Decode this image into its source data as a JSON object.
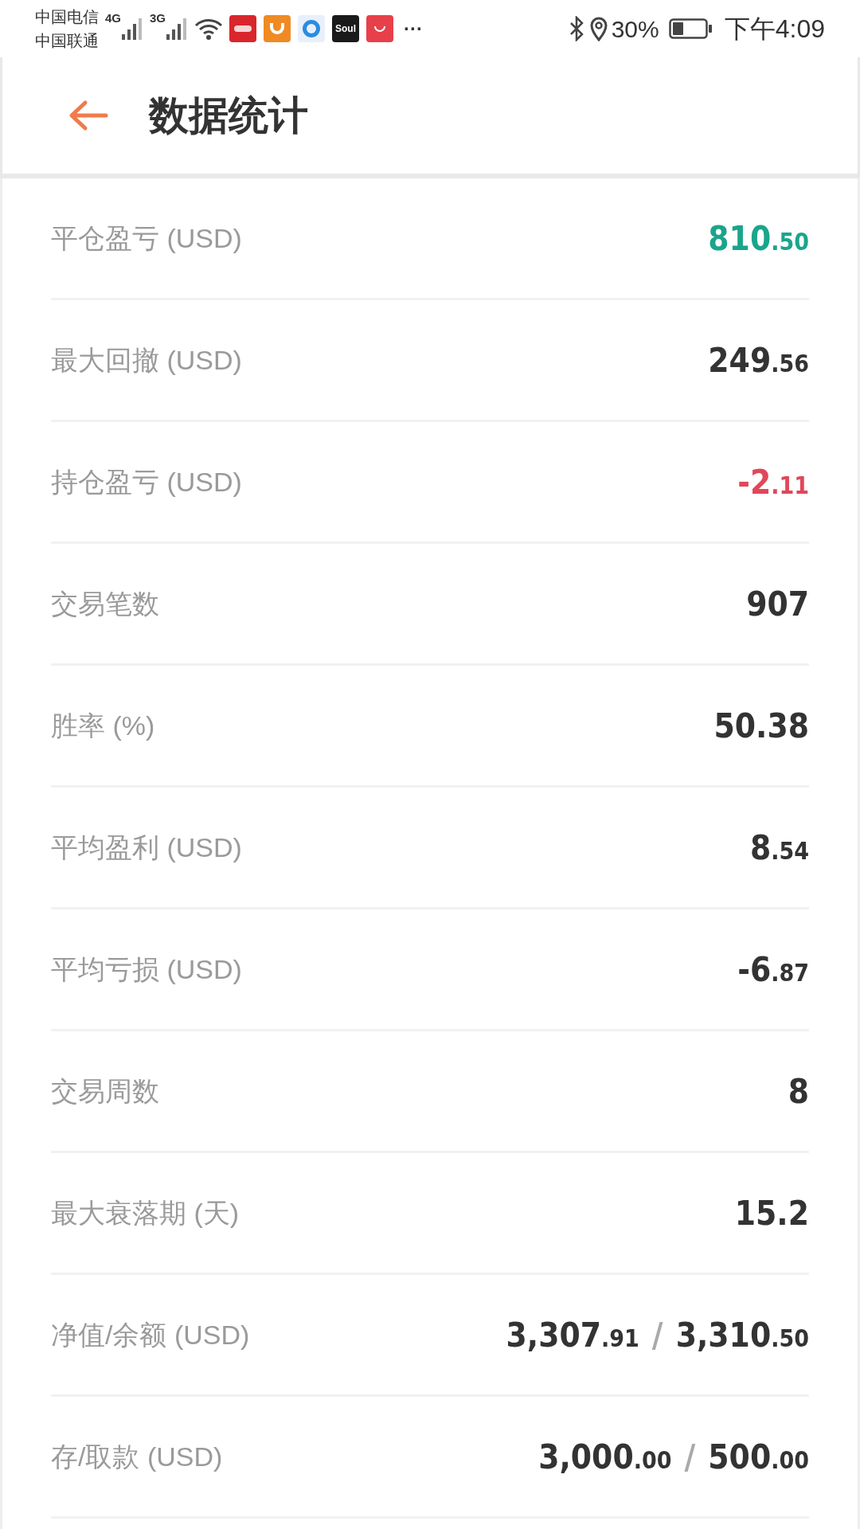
{
  "status_bar": {
    "carriers": [
      "中国电信",
      "中国联通"
    ],
    "networks": [
      "4G",
      "3G"
    ],
    "apps": [
      {
        "kind": "red"
      },
      {
        "kind": "uc"
      },
      {
        "kind": "browser"
      },
      {
        "kind": "soul",
        "label": "Soul"
      },
      {
        "kind": "huawei"
      }
    ],
    "more": "···",
    "battery_text": "30%",
    "time": "下午4:09"
  },
  "header": {
    "title": "数据统计"
  },
  "stats": [
    {
      "label": "平仓盈亏 (USD)",
      "color": "#1aa58c",
      "value": [
        {
          "kind": "big",
          "text": "810"
        },
        {
          "kind": "small",
          "text": ".50"
        }
      ]
    },
    {
      "label": "最大回撤 (USD)",
      "color": "#333333",
      "value": [
        {
          "kind": "big",
          "text": "249"
        },
        {
          "kind": "small",
          "text": ".56"
        }
      ]
    },
    {
      "label": "持仓盈亏 (USD)",
      "color": "#e0475a",
      "value": [
        {
          "kind": "big",
          "text": "-2"
        },
        {
          "kind": "small",
          "text": ".11"
        }
      ]
    },
    {
      "label": "交易笔数",
      "color": "#333333",
      "value": [
        {
          "kind": "big",
          "text": "907"
        }
      ]
    },
    {
      "label": "胜率 (%)",
      "color": "#333333",
      "value": [
        {
          "kind": "big",
          "text": "50.38"
        }
      ]
    },
    {
      "label": "平均盈利 (USD)",
      "color": "#333333",
      "value": [
        {
          "kind": "big",
          "text": "8"
        },
        {
          "kind": "small",
          "text": ".54"
        }
      ]
    },
    {
      "label": "平均亏损 (USD)",
      "color": "#333333",
      "value": [
        {
          "kind": "big",
          "text": "-6"
        },
        {
          "kind": "small",
          "text": ".87"
        }
      ]
    },
    {
      "label": "交易周数",
      "color": "#333333",
      "value": [
        {
          "kind": "big",
          "text": "8"
        }
      ]
    },
    {
      "label": "最大衰落期 (天)",
      "color": "#333333",
      "value": [
        {
          "kind": "big",
          "text": "15.2"
        }
      ]
    },
    {
      "label": "净值/余额 (USD)",
      "color": "#333333",
      "value": [
        {
          "kind": "big",
          "text": "3,307"
        },
        {
          "kind": "small",
          "text": ".91"
        },
        {
          "kind": "sep",
          "text": "/"
        },
        {
          "kind": "big",
          "text": "3,310"
        },
        {
          "kind": "small",
          "text": ".50"
        }
      ]
    },
    {
      "label": "存/取款 (USD)",
      "color": "#333333",
      "value": [
        {
          "kind": "big",
          "text": "3,000"
        },
        {
          "kind": "small",
          "text": ".00"
        },
        {
          "kind": "sep",
          "text": "/"
        },
        {
          "kind": "big",
          "text": "500"
        },
        {
          "kind": "small",
          "text": ".00"
        }
      ]
    }
  ]
}
